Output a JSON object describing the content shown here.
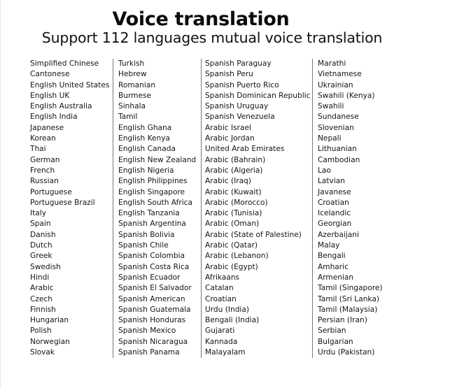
{
  "header": {
    "title": "Voice translation",
    "subtitle": "Support 112 languages mutual voice translation"
  },
  "columns": [
    {
      "items": [
        "Simplified Chinese",
        "Cantonese",
        "English United States",
        "English UK",
        "English Australia",
        "English India",
        "Japanese",
        "Korean",
        "Thai",
        "German",
        "French",
        "Russian",
        "Portuguese",
        "Portuguese Brazil",
        "Italy",
        "Spain",
        "Danish",
        "Dutch",
        "Greek",
        "Swedish",
        "Hindi",
        "Arabic",
        "Czech",
        "Finnish",
        "Hungarian",
        "Polish",
        "Norwegian",
        "Slovak"
      ]
    },
    {
      "items": [
        "Turkish",
        "Hebrew",
        "Romanian",
        "Burmese",
        "Sinhala",
        "Tamil",
        "English Ghana",
        "English Kenya",
        "English Canada",
        "English New Zealand",
        "English Nigeria",
        "English Philippines",
        "English Singapore",
        "English South Africa",
        "English Tanzania",
        "Spanish Argentina",
        "Spanish Bolivia",
        "Spanish Chile",
        "Spanish Colombia",
        "Spanish Costa Rica",
        "Spanish Ecuador",
        "Spanish El Salvador",
        "Spanish American",
        "Spanish Guatemala",
        "Spanish Honduras",
        "Spanish Mexico",
        "Spanish Nicaragua",
        "Spanish Panama"
      ]
    },
    {
      "items": [
        "Spanish Paraguay",
        "Spanish Peru",
        "Spanish Puerto Rico",
        "Spanish Dominican Republic",
        "Spanish Uruguay",
        "Spanish Venezuela",
        "Arabic Israel",
        "Arabic Jordan",
        "United Arab Emirates",
        "Arabic (Bahrain)",
        "Arabic (Algeria)",
        "Arabic (Iraq)",
        "Arabic (Kuwait)",
        "Arabic (Morocco)",
        "Arabic (Tunisia)",
        "Arabic (Oman)",
        "Arabic (State of Palestine)",
        "Arabic (Qatar)",
        "Arabic (Lebanon)",
        "Arabic (Egypt)",
        "Afrikaans",
        "Catalan",
        "Croatian",
        "Urdu (India)",
        "Bengali (India)",
        "Gujarati",
        "Kannada",
        "Malayalam"
      ]
    },
    {
      "items": [
        "Marathi",
        "Vietnamese",
        "Ukrainian",
        "Swahili (Kenya)",
        "Swahili",
        "Sundanese",
        "Slovenian",
        "Nepali",
        "Lithuanian",
        "Cambodian",
        "Lao",
        "Latvian",
        "Javanese",
        "Croatian",
        "Icelandic",
        "Georgian",
        "Azerbaijani",
        "Malay",
        "Bengali",
        "Amharic",
        "Armenian",
        "Tamil (Singapore)",
        "Tamil (Sri Lanka)",
        "Tamil (Malaysia)",
        "Persian (Iran)",
        "Serbian",
        "Bulgarian",
        "Urdu (Pakistan)"
      ]
    }
  ]
}
